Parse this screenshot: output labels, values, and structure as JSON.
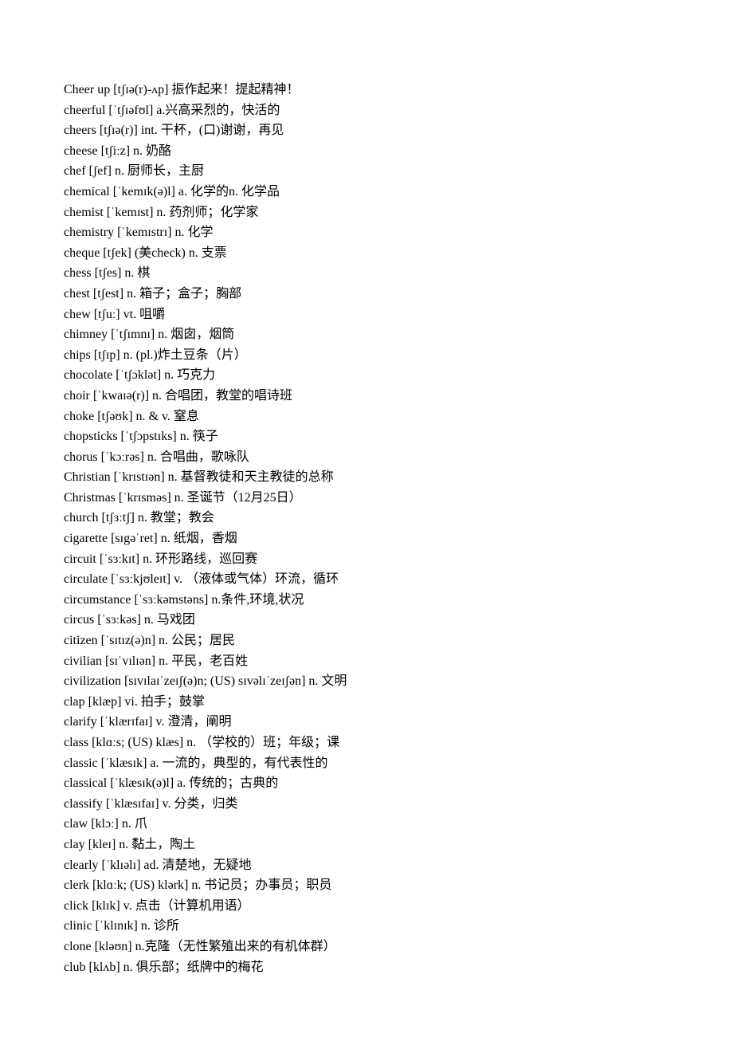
{
  "entries": [
    {
      "text": "Cheer up [tʃɪə(r)-ʌp] 振作起来！提起精神！"
    },
    {
      "text": "cheerful [ˈtʃɪəfʊl] a.兴高采烈的，快活的"
    },
    {
      "text": "cheers [tʃɪə(r)] int. 干杯，(口)谢谢，再见"
    },
    {
      "text": "cheese [tʃiːz] n. 奶酪"
    },
    {
      "text": "chef [ʃef] n. 厨师长，主厨"
    },
    {
      "text": "chemical [ˈkemɪk(ə)l] a. 化学的n. 化学品"
    },
    {
      "text": "chemist [ˈkemɪst] n. 药剂师；化学家"
    },
    {
      "text": "chemistry [ˈkemɪstrɪ] n. 化学"
    },
    {
      "text": "cheque [tʃek] (美check) n. 支票"
    },
    {
      "text": "chess [tʃes] n. 棋"
    },
    {
      "text": "chest [tʃest] n. 箱子；盒子；胸部"
    },
    {
      "text": "chew [tʃuː] vt. 咀嚼"
    },
    {
      "text": "chimney [ˈtʃɪmnɪ] n. 烟囱，烟筒"
    },
    {
      "text": "chips [tʃɪp] n. (pl.)炸土豆条（片）"
    },
    {
      "text": "chocolate [ˈtʃɔklət] n. 巧克力"
    },
    {
      "text": "choir [ˈkwaɪə(r)] n. 合唱团，教堂的唱诗班"
    },
    {
      "text": "choke [tʃəʊk] n. & v. 窒息"
    },
    {
      "text": "chopsticks [ˈtʃɔpstɪks] n. 筷子"
    },
    {
      "text": "chorus [ˈkɔːrəs] n. 合唱曲，歌咏队"
    },
    {
      "text": "Christian [ˈkrɪstɪən] n. 基督教徒和天主教徒的总称"
    },
    {
      "text": "Christmas [ˈkrɪsməs] n. 圣诞节（12月25日）"
    },
    {
      "text": "church [tʃɜːtʃ] n. 教堂；教会"
    },
    {
      "text": "cigarette [sɪgəˈret] n. 纸烟，香烟"
    },
    {
      "text": "circuit [ˈsɜːkɪt] n. 环形路线，巡回赛"
    },
    {
      "text": "circulate [ˈsɜːkjʊleɪt] v. （液体或气体）环流，循环"
    },
    {
      "text": "circumstance [ˈsɜːkəmstəns] n.条件,环境,状况"
    },
    {
      "text": "circus [ˈsɜːkəs] n. 马戏团"
    },
    {
      "text": "citizen [ˈsɪtɪz(ə)n] n. 公民；居民"
    },
    {
      "text": "civilian [sɪˈvɪlɪən] n. 平民，老百姓"
    },
    {
      "text": "civilization [sɪvɪlaɪˈzeɪʃ(ə)n; (US) sɪvəlɪˈzeɪʃən] n. 文明"
    },
    {
      "text": "clap [klæp] vi. 拍手；鼓掌"
    },
    {
      "text": "clarify [ˈklærɪfaɪ] v. 澄清，阐明"
    },
    {
      "text": "class [klɑːs; (US) klæs] n. （学校的）班；年级；课"
    },
    {
      "text": "classic [ˈklæsɪk] a. 一流的，典型的，有代表性的"
    },
    {
      "text": "classical [ˈklæsɪk(ə)l] a. 传统的；古典的"
    },
    {
      "text": "classify [ˈklæsɪfaɪ] v. 分类，归类"
    },
    {
      "text": "claw [klɔː] n. 爪"
    },
    {
      "text": "clay [kleɪ] n. 黏土，陶土"
    },
    {
      "text": "clearly [ˈklɪəlɪ] ad. 清楚地，无疑地"
    },
    {
      "text": "clerk [klɑːk; (US) klərk] n. 书记员；办事员；职员"
    },
    {
      "text": "click [klɪk] v. 点击（计算机用语）"
    },
    {
      "text": "clinic [ˈklɪnɪk] n. 诊所"
    },
    {
      "text": "clone [kləʊn] n.克隆（无性繁殖出来的有机体群）"
    },
    {
      "text": "club [klʌb] n. 俱乐部；纸牌中的梅花"
    }
  ]
}
